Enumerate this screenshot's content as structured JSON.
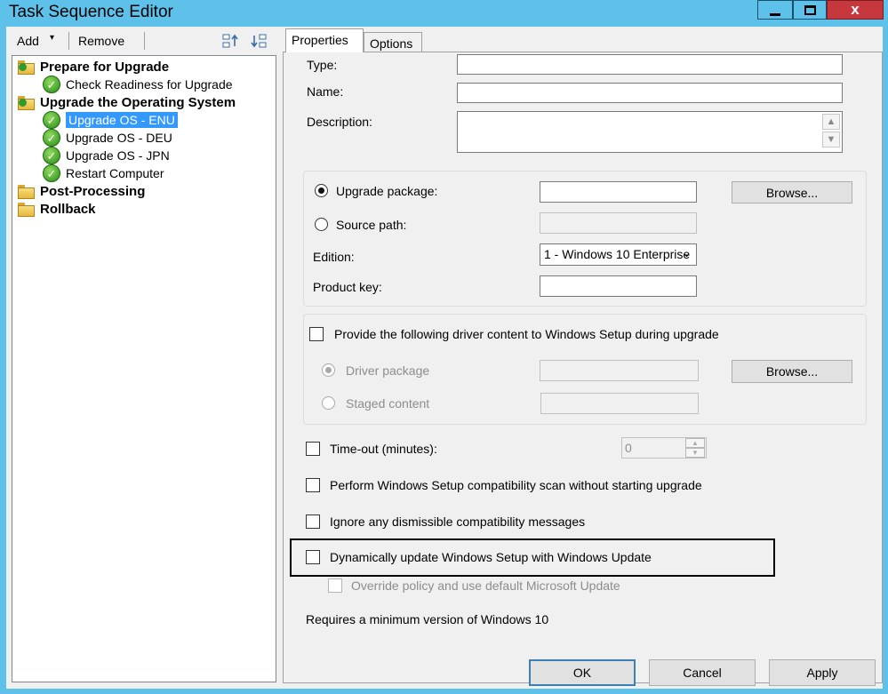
{
  "window": {
    "title": "Task Sequence Editor",
    "close_glyph": "x"
  },
  "toolbar": {
    "add_label": "Add",
    "add_arrow": "▾",
    "remove_label": "Remove"
  },
  "tree": {
    "groups": [
      {
        "label": "Prepare for Upgrade"
      },
      {
        "label": "Upgrade the Operating System"
      },
      {
        "label": "Post-Processing"
      },
      {
        "label": "Rollback"
      }
    ],
    "steps": [
      {
        "label": "Check Readiness for Upgrade",
        "selected": false
      },
      {
        "label": "Upgrade OS - ENU",
        "selected": true
      },
      {
        "label": "Upgrade OS - DEU",
        "selected": false
      },
      {
        "label": "Upgrade OS - JPN",
        "selected": false
      },
      {
        "label": "Restart Computer",
        "selected": false
      }
    ]
  },
  "tabs": {
    "properties": "Properties",
    "options": "Options"
  },
  "fields": {
    "type_label": "Type:",
    "name_label": "Name:",
    "description_label": "Description:",
    "upgrade_package_label": "Upgrade package:",
    "source_path_label": "Source path:",
    "edition_label": "Edition:",
    "edition_value": "1 - Windows 10 Enterprise",
    "product_key_label": "Product key:",
    "browse_label": "Browse...",
    "driver_content_label": "Provide the following driver content to Windows Setup during upgrade",
    "driver_package_label": "Driver package",
    "staged_content_label": "Staged content",
    "timeout_label": "Time-out (minutes):",
    "timeout_value": "0",
    "compat_scan_label": "Perform Windows Setup compatibility scan without starting upgrade",
    "ignore_messages_label": "Ignore any dismissible compatibility messages",
    "dynamic_update_label": "Dynamically update Windows Setup with Windows Update",
    "override_policy_label": "Override policy and use default Microsoft Update",
    "requires_note": "Requires a minimum version of Windows 10"
  },
  "buttons": {
    "ok": "OK",
    "cancel": "Cancel",
    "apply": "Apply"
  }
}
